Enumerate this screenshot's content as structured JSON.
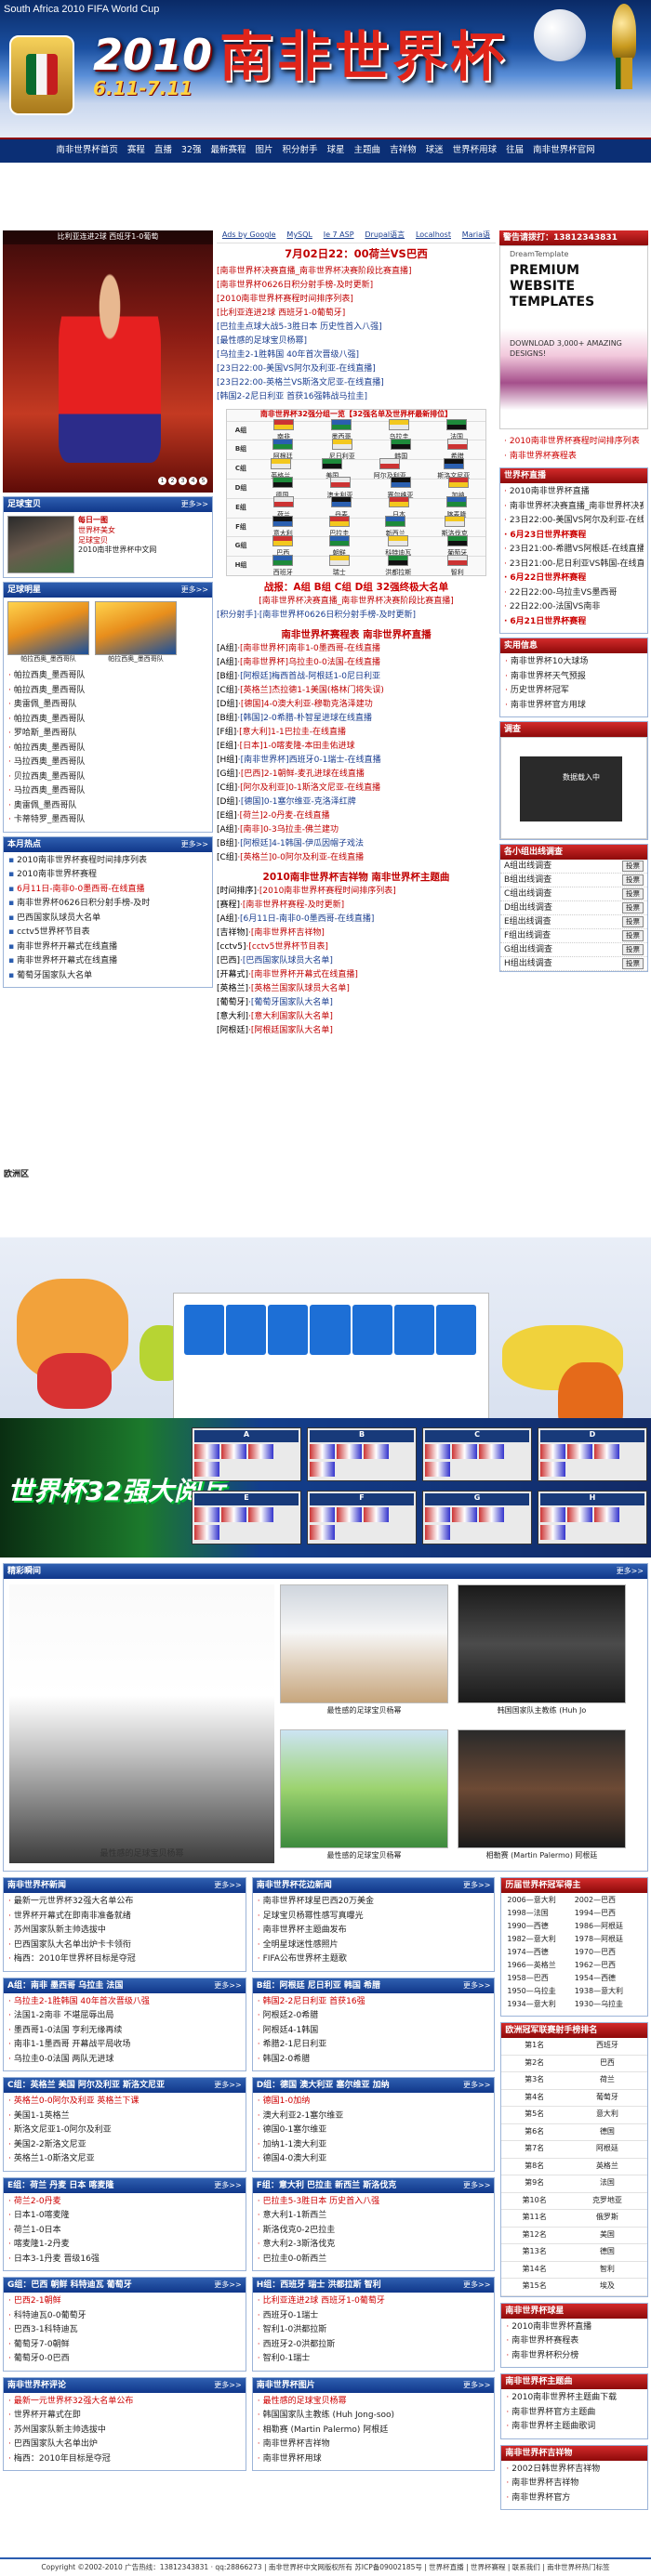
{
  "banner": {
    "tagline": "South Africa 2010 FIFA World Cup",
    "year": "2010",
    "dates": "6.11-7.11",
    "title": "南非世界杯"
  },
  "nav": [
    "南非世界杯首页",
    "赛程",
    "直播",
    "32强",
    "最新赛程",
    "图片",
    "积分射手",
    "球星",
    "主题曲",
    "吉祥物",
    "球迷",
    "世界杯用球",
    "往届",
    "南非世界杯官网"
  ],
  "adbar": [
    "Ads by Google",
    "MySQL",
    "Ie 7 ASP",
    "Drupal语言",
    "Localhost",
    "Maria语"
  ],
  "col1": {
    "photo_caption": "比利亚连进2球 西班牙1-0葡萄",
    "pager": [
      "1",
      "2",
      "3",
      "4",
      "5"
    ],
    "section1_title": "足球宝贝",
    "section1_more": "更多>>",
    "baby_items": [
      "每日一图",
      "世界杯美女",
      "足球宝贝"
    ],
    "baby_text": "2010南非世界杯中文网",
    "section2_title": "足球明星",
    "section2_more": "更多>>",
    "star_captions": [
      "帕拉西奥_墨西哥队",
      "帕拉西奥_墨西哥队"
    ],
    "star_list": [
      "帕拉西奥_墨西哥队",
      "帕拉西奥_墨西哥队",
      "奥雷佩_墨西哥队",
      "帕拉西奥_墨西哥队",
      "罗哈斯_墨西哥队",
      "帕拉西奥_墨西哥队",
      "马拉西奥_墨西哥队",
      "贝拉西奥_墨西哥队",
      "马拉西奥_墨西哥队",
      "奥雷佩_墨西哥队",
      "卡蒂特罗_墨西哥队"
    ],
    "section3_title": "本月热点",
    "section3_more": "更多>>",
    "hot_list": [
      "2010南非世界杯赛程时间排序列表",
      "2010南非世界杯赛程",
      "6月11日-南非0-0墨西哥-在线直播",
      "南非世界杯0626日积分射手榜-及时",
      "巴西国家队球员大名单",
      "cctv5世界杯节目表",
      "南非世界杯开幕式在线直播",
      "南非世界杯开幕式在线直播",
      "葡萄牙国家队大名单"
    ]
  },
  "col2": {
    "headline": "7月02日22：00荷兰VS巴西",
    "top_links": [
      "[南非世界杯决赛直播_南非世界杯决赛阶段比赛直播]",
      "[南非世界杯0626日积分射手榜-及时更新]",
      "[2010南非世界杯赛程时间排序列表]",
      "[比利亚连进2球 西班牙1-0葡萄牙]",
      "[巴拉圭点球大战5-3胜日本 历史性首入八强]",
      "[最性感的足球宝贝杨幂]",
      "[乌拉圭2-1胜韩国 40年首次晋级八强]",
      "[23日22:00-美国VS阿尔及利亚-在线直播]",
      "[23日22:00-英格兰VS斯洛文尼亚-在线直播]",
      "[韩国2-2尼日利亚 首获16强韩战马拉圭]"
    ],
    "groups_title": "南非世界杯32强分组一览【32强名单及世界杯最新排位】",
    "groups": [
      {
        "g": "A组",
        "teams": [
          "南非",
          "墨西哥",
          "乌拉圭",
          "法国"
        ]
      },
      {
        "g": "B组",
        "teams": [
          "阿根廷",
          "尼日利亚",
          "韩国",
          "希腊"
        ]
      },
      {
        "g": "C组",
        "teams": [
          "英格兰",
          "美国",
          "阿尔及利亚",
          "斯洛文尼亚"
        ]
      },
      {
        "g": "D组",
        "teams": [
          "德国",
          "澳大利亚",
          "塞尔维亚",
          "加纳"
        ]
      },
      {
        "g": "E组",
        "teams": [
          "荷兰",
          "丹麦",
          "日本",
          "喀麦隆"
        ]
      },
      {
        "g": "F组",
        "teams": [
          "意大利",
          "巴拉圭",
          "新西兰",
          "斯洛伐克"
        ]
      },
      {
        "g": "G组",
        "teams": [
          "巴西",
          "朝鲜",
          "科特迪瓦",
          "葡萄牙"
        ]
      },
      {
        "g": "H组",
        "teams": [
          "西班牙",
          "瑞士",
          "洪都拉斯",
          "智利"
        ]
      }
    ],
    "group_heading": "战报：A组 B组 C组 D组 32强终极大名单",
    "group_sub": "[南非世界杯决赛直播_南非世界杯决赛阶段比赛直播]",
    "group_sub2": "[积分射手]·[南非世界杯0626日积分射手榜-及时更新]",
    "live_heading": "南非世界杯赛程表 南非世界杯直播",
    "live": [
      {
        "tag": "[A组]",
        "txt": "·[南非世界杯]南非1-0墨西哥-在线直播"
      },
      {
        "tag": "[A组]",
        "txt": "·[南非世界杯]乌拉圭0-0法国-在线直播"
      },
      {
        "tag": "[B组]",
        "txt": "·[阿根廷]梅西首战-阿根廷1-0尼日利亚"
      },
      {
        "tag": "[C组]",
        "txt": "·[英格兰]杰拉德1-1美国(格林门将失误)"
      },
      {
        "tag": "[D组]",
        "txt": "·[德国]4-0澳大利亚-穆勒克洛泽建功"
      },
      {
        "tag": "[B组]",
        "txt": "·[韩国]2-0希腊-朴智星进球在线直播"
      },
      {
        "tag": "[F组]",
        "txt": "·[意大利]1-1巴拉圭-在线直播"
      },
      {
        "tag": "[E组]",
        "txt": "·[日本]1-0喀麦隆-本田圭佑进球"
      },
      {
        "tag": "[H组]",
        "txt": "·[南非世界杯]西班牙0-1瑞士-在线直播"
      },
      {
        "tag": "[G组]",
        "txt": "·[巴西]2-1朝鲜-麦孔进球在线直播"
      },
      {
        "tag": "[C组]",
        "txt": "·[阿尔及利亚]0-1斯洛文尼亚-在线直播"
      },
      {
        "tag": "[D组]",
        "txt": "·[德国]0-1塞尔维亚-克洛泽红牌"
      },
      {
        "tag": "[E组]",
        "txt": "·[荷兰]2-0丹麦-在线直播"
      },
      {
        "tag": "[A组]",
        "txt": "·[南非]0-3乌拉圭-佛兰建功"
      },
      {
        "tag": "[B组]",
        "txt": "·[阿根廷]4-1韩国-伊瓜因帽子戏法"
      },
      {
        "tag": "[C组]",
        "txt": "·[英格兰]0-0阿尔及利亚-在线直播"
      }
    ],
    "song_heading": "2010南非世界杯吉祥物 南非世界杯主题曲",
    "songs": [
      {
        "tag": "[时间排序]",
        "txt": "·[2010南非世界杯赛程时间排序列表]"
      },
      {
        "tag": "[赛程]",
        "txt": "·[南非世界杯赛程-及时更新]"
      },
      {
        "tag": "[A组]",
        "txt": "·[6月11日-南非0-0墨西哥-在线直播]"
      },
      {
        "tag": "[吉祥物]",
        "txt": "·[南非世界杯吉祥物]"
      },
      {
        "tag": "[cctv5]",
        "txt": "·[cctv5世界杯节目表]"
      },
      {
        "tag": "[巴西]",
        "txt": "·[巴西国家队球员大名单]"
      },
      {
        "tag": "[开幕式]",
        "txt": "·[南非世界杯开幕式在线直播]"
      },
      {
        "tag": "[英格兰]",
        "txt": "·[英格兰国家队球员大名单]"
      },
      {
        "tag": "[葡萄牙]",
        "txt": "·[葡萄牙国家队大名单]"
      },
      {
        "tag": "[意大利]",
        "txt": "·[意大利国家队大名单]"
      },
      {
        "tag": "[阿根廷]",
        "txt": "·[阿根廷国家队大名单]"
      }
    ]
  },
  "col3": {
    "contact": "警告请拨打：13812343831",
    "ad_brand": "DreamTemplate",
    "ad_headline": [
      "PREMIUM",
      "WEBSITE",
      "TEMPLATES"
    ],
    "ad_download": "DOWNLOAD 3,000+ AMAZING DESIGNS!",
    "top_links": [
      "2010南非世界杯赛程时间排序列表",
      "南非世界杯赛程表"
    ],
    "sec1": "世界杯直播",
    "live_list": [
      "2010南非世界杯直播",
      "南非世界杯决赛直播_南非世界杯决赛阶段比赛直播",
      "23日22:00-美国VS阿尔及利亚-在线直播",
      "6月23日世界杯赛程",
      "23日21:00-希腊VS阿根廷-在线直播",
      "23日21:00-尼日利亚VS韩国-在线直播",
      "6月22日世界杯赛程",
      "22日22:00-乌拉圭VS墨西哥",
      "22日22:00-法国VS南非",
      "6月21日世界杯赛程"
    ],
    "sec2": "实用信息",
    "info_list": [
      "南非世界杯10大球场",
      "南非世界杯天气预报",
      "历史世界杯冠军",
      "南非世界杯官方用球"
    ],
    "sec3": "调查",
    "vote_card": "数据载入中",
    "sec4": "各小组出线调查",
    "poll": [
      [
        "A组出线调查",
        "投票"
      ],
      [
        "B组出线调查",
        "投票"
      ],
      [
        "C组出线调查",
        "投票"
      ],
      [
        "D组出线调查",
        "投票"
      ],
      [
        "E组出线调查",
        "投票"
      ],
      [
        "F组出线调查",
        "投票"
      ],
      [
        "G组出线调查",
        "投票"
      ],
      [
        "H组出线调查",
        "投票"
      ]
    ]
  },
  "map": {
    "label": "欧洲区",
    "finale": "世界杯32强大阅兵",
    "groups": [
      "A",
      "B",
      "C",
      "D",
      "E",
      "F",
      "G",
      "H"
    ]
  },
  "feature": {
    "title": "精彩瞬间",
    "more": "更多>>",
    "big_caption": "最性感的足球宝贝杨幂",
    "captions": [
      "最性感的足球宝贝杨幂",
      "韩国国家队主教练 (Huh Jo",
      "最性感的足球宝贝杨幂",
      "相勒赛 (Martin Palermo) 阿根廷"
    ]
  },
  "lower": {
    "boxes": [
      {
        "t": "南非世界杯新闻",
        "items": [
          "最新一元世界杯32强大名单公布",
          "世界杯开幕式在即南非准备就绪",
          "苏州国家队新主帅选拔中",
          "巴西国家队大名单出炉卡卡领衔",
          "梅西：2010年世界杯目标是夺冠"
        ]
      },
      {
        "t": "A组：南非 墨西哥 乌拉圭 法国",
        "items": [
          "乌拉圭2-1胜韩国 40年首次晋级八强",
          "法国1-2南非 不堪屈辱出局",
          "墨西哥1-0法国 亨利无缘再续",
          "南非1-1墨西哥 开幕战平局收场",
          "乌拉圭0-0法国 两队无进球"
        ]
      },
      {
        "t": "C组：英格兰 美国 阿尔及利亚 斯洛文尼亚",
        "items": [
          "英格兰0-0阿尔及利亚 英格兰下课",
          "美国1-1英格兰",
          "斯洛文尼亚1-0阿尔及利亚",
          "美国2-2斯洛文尼亚",
          "英格兰1-0斯洛文尼亚"
        ]
      },
      {
        "t": "E组：荷兰 丹麦 日本 喀麦隆",
        "items": [
          "荷兰2-0丹麦",
          "日本1-0喀麦隆",
          "荷兰1-0日本",
          "喀麦隆1-2丹麦",
          "日本3-1丹麦 晋级16强"
        ]
      },
      {
        "t": "G组：巴西 朝鲜 科特迪瓦 葡萄牙",
        "items": [
          "巴西2-1朝鲜",
          "科特迪瓦0-0葡萄牙",
          "巴西3-1科特迪瓦",
          "葡萄牙7-0朝鲜",
          "葡萄牙0-0巴西"
        ]
      },
      {
        "t": "南非世界杯评论",
        "items": [
          "最新一元世界杯32强大名单公布",
          "世界杯开幕式在即",
          "苏州国家队新主帅选拔中",
          "巴西国家队大名单出炉",
          "梅西：2010年目标是夺冠"
        ]
      }
    ],
    "boxes2": [
      {
        "t": "南非世界杯花边新闻",
        "items": [
          "南非世界杯球星巴西20万美金",
          "足球宝贝杨幂性感写真曝光",
          "南非世界杯主题曲发布",
          "全明星球迷性感照片",
          "FIFA公布世界杯主题歌"
        ]
      },
      {
        "t": "B组：阿根廷 尼日利亚 韩国 希腊",
        "items": [
          "韩国2-2尼日利亚 首获16强",
          "阿根廷2-0希腊",
          "阿根廷4-1韩国",
          "希腊2-1尼日利亚",
          "韩国2-0希腊"
        ]
      },
      {
        "t": "D组：德国 澳大利亚 塞尔维亚 加纳",
        "items": [
          "德国1-0加纳",
          "澳大利亚2-1塞尔维亚",
          "德国0-1塞尔维亚",
          "加纳1-1澳大利亚",
          "德国4-0澳大利亚"
        ]
      },
      {
        "t": "F组：意大利 巴拉圭 新西兰 斯洛伐克",
        "items": [
          "巴拉圭5-3胜日本 历史首入八强",
          "意大利1-1新西兰",
          "斯洛伐克0-2巴拉圭",
          "意大利2-3斯洛伐克",
          "巴拉圭0-0新西兰"
        ]
      },
      {
        "t": "H组：西班牙 瑞士 洪都拉斯 智利",
        "items": [
          "比利亚连进2球 西班牙1-0葡萄牙",
          "西班牙0-1瑞士",
          "智利1-0洪都拉斯",
          "西班牙2-0洪都拉斯",
          "智利0-1瑞士"
        ]
      },
      {
        "t": "南非世界杯图片",
        "items": [
          "最性感的足球宝贝杨幂",
          "韩国国家队主教练 (Huh Jong-soo)",
          "相勒赛 (Martin Palermo) 阿根廷",
          "南非世界杯吉祥物",
          "南非世界杯用球"
        ]
      }
    ],
    "history_title": "历届世界杯冠军得主",
    "history": [
      [
        "2006—意大利",
        "2002—巴西"
      ],
      [
        "1998—法国",
        "1994—巴西"
      ],
      [
        "1990—西德",
        "1986—阿根廷"
      ],
      [
        "1982—意大利",
        "1978—阿根廷"
      ],
      [
        "1974—西德",
        "1970—巴西"
      ],
      [
        "1966—英格兰",
        "1962—巴西"
      ],
      [
        "1958—巴西",
        "1954—西德"
      ],
      [
        "1950—乌拉圭",
        "1938—意大利"
      ],
      [
        "1934—意大利",
        "1930—乌拉圭"
      ]
    ],
    "rank_title": "欧洲冠军联赛射手榜排名",
    "rank": [
      [
        "第1名",
        "西班牙"
      ],
      [
        "第2名",
        "巴西"
      ],
      [
        "第3名",
        "荷兰"
      ],
      [
        "第4名",
        "葡萄牙"
      ],
      [
        "第5名",
        "意大利"
      ],
      [
        "第6名",
        "德国"
      ],
      [
        "第7名",
        "阿根廷"
      ],
      [
        "第8名",
        "英格兰"
      ],
      [
        "第9名",
        "法国"
      ],
      [
        "第10名",
        "克罗地亚"
      ],
      [
        "第11名",
        "俄罗斯"
      ],
      [
        "第12名",
        "美国"
      ],
      [
        "第13名",
        "德国"
      ],
      [
        "第14名",
        "智利"
      ],
      [
        "第15名",
        "埃及"
      ]
    ],
    "r1": "南非世界杯球星",
    "r1_items": [
      "2010南非世界杯直播",
      "南非世界杯赛程表",
      "南非世界杯积分榜"
    ],
    "r2": "南非世界杯主题曲",
    "r2_items": [
      "2010南非世界杯主题曲下载",
      "南非世界杯官方主题曲",
      "南非世界杯主题曲歌词"
    ],
    "r3": "南非世界杯吉祥物",
    "r3_items": [
      "2002日韩世界杯吉祥物",
      "南非世界杯吉祥物",
      "南非世界杯官方"
    ]
  },
  "footer": "Copyright ©2002-2010 广告热线：13812343831 · qq:28866273 | 南非世界杯中文网版权所有 苏ICP备09002185号 | 世界杯直播 | 世界杯赛程 | 联系我们 | 南非世界杯热门标签"
}
